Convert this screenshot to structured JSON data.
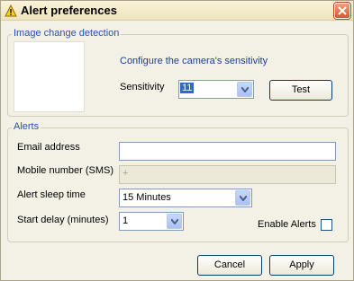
{
  "window": {
    "title": "Alert preferences"
  },
  "image_section": {
    "legend": "Image change detection",
    "configure_text": "Configure the camera's sensitivity",
    "sensitivity_label": "Sensitivity",
    "sensitivity_value": "11",
    "test_label": "Test"
  },
  "alerts_section": {
    "legend": "Alerts",
    "email_label": "Email address",
    "email_value": "",
    "mobile_label": "Mobile number (SMS)",
    "mobile_value": "+",
    "sleep_label": "Alert sleep time",
    "sleep_value": "15 Minutes",
    "delay_label": "Start delay (minutes)",
    "delay_value": "1",
    "enable_label": "Enable Alerts",
    "enable_checked": false
  },
  "footer": {
    "cancel_label": "Cancel",
    "apply_label": "Apply"
  },
  "colors": {
    "legend": "#2651b8",
    "accent": "#316ac5"
  }
}
